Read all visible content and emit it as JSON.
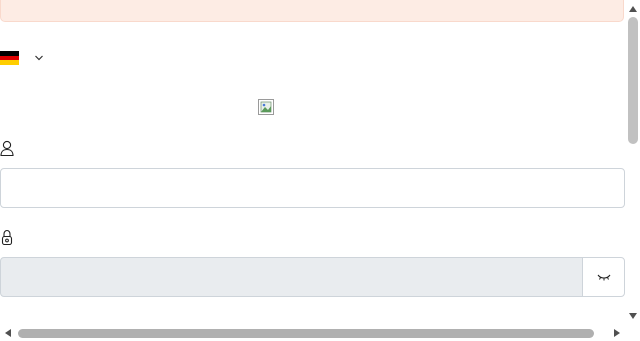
{
  "alert": {
    "text": "",
    "bg_color": "#fdece4"
  },
  "language": {
    "flag_icon": "flag-germany-icon",
    "flag_colors": [
      "#000000",
      "#dd0000",
      "#ffce00"
    ],
    "dropdown_icon": "chevron-down-icon"
  },
  "logo": {
    "icon": "broken-image-icon",
    "alt": ""
  },
  "username": {
    "icon": "user-icon",
    "value": "",
    "placeholder": ""
  },
  "password": {
    "icon": "lock-icon",
    "value": "",
    "placeholder": "",
    "toggle_icon": "eye-closed-icon"
  },
  "scrollbars": {
    "vertical_position": 0.0,
    "horizontal_position": 0.0
  }
}
